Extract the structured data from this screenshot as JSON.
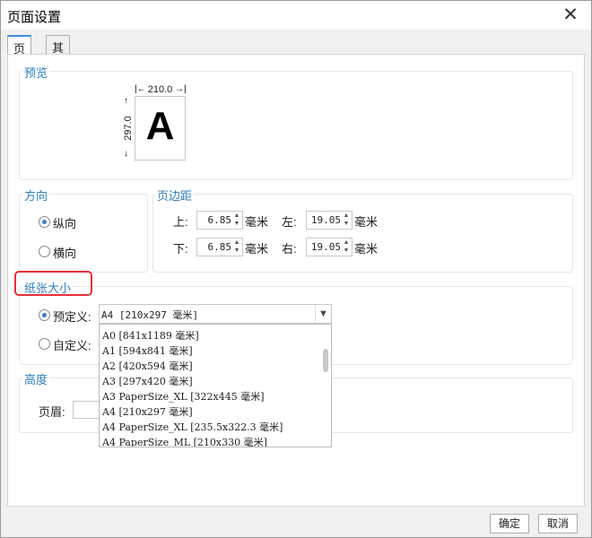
{
  "window": {
    "title": "页面设置",
    "close_glyph": "✕"
  },
  "tabs": [
    {
      "label": "页面",
      "active": true
    },
    {
      "label": "其他",
      "active": false
    }
  ],
  "preview": {
    "title": "预览",
    "width_label": "210.0",
    "height_label": "297.0",
    "letter": "A"
  },
  "orientation": {
    "title": "方向",
    "options": [
      {
        "label": "纵向",
        "checked": true
      },
      {
        "label": "横向",
        "checked": false
      }
    ]
  },
  "margins": {
    "title": "页边距",
    "unit": "毫米",
    "top": {
      "label": "上:",
      "value": "6.85"
    },
    "bottom": {
      "label": "下:",
      "value": "6.85"
    },
    "left": {
      "label": "左:",
      "value": "19.05"
    },
    "right": {
      "label": "右:",
      "value": "19.05"
    }
  },
  "paper": {
    "title": "纸张大小",
    "predefined_label": "预定义:",
    "custom_label": "自定义:",
    "selected": "A4 [210x297 毫米]",
    "options": [
      "A0 [841x1189 毫米]",
      "A1 [594x841 毫米]",
      "A2 [420x594 毫米]",
      "A3 [297x420 毫米]",
      "A3 PaperSize_XL [322x445 毫米]",
      "A4 [210x297 毫米]",
      "A4 PaperSize_XL [235.5x322.3 毫米]",
      "A4 PaperSize_ML [210x330 毫米]"
    ]
  },
  "height_section": {
    "title": "高度",
    "header_label": "页眉:"
  },
  "footer": {
    "ok_label": "确定",
    "cancel_label": "取消"
  },
  "colors": {
    "accent": "#2d7fbf",
    "highlight": "#e8303a",
    "tab_accent": "#3c8dde"
  }
}
